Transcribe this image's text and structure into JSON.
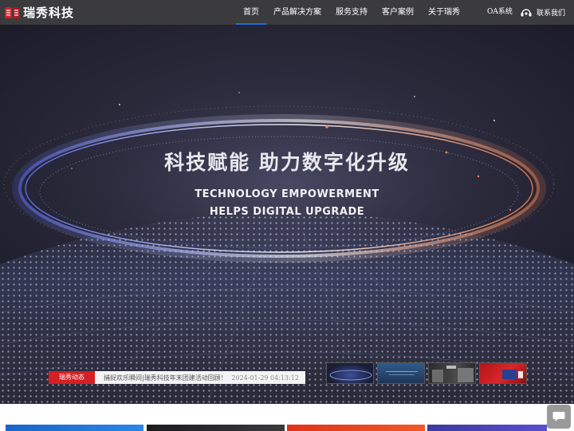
{
  "header": {
    "logo_text": "瑞秀科技",
    "nav": [
      {
        "label": "首页",
        "active": true
      },
      {
        "label": "产品解决方案",
        "active": false
      },
      {
        "label": "服务支持",
        "active": false
      },
      {
        "label": "客户案例",
        "active": false
      },
      {
        "label": "关于瑞秀",
        "active": false
      }
    ],
    "oa_label": "OA系统",
    "contact_label": "联系我们"
  },
  "hero": {
    "title": "科技赋能  助力数字化升级",
    "subtitle_line1": "TECHNOLOGY EMPOWERMENT",
    "subtitle_line2": "HELPS DIGITAL UPGRADE"
  },
  "news": {
    "tag": "瑞秀动态",
    "headline": "捕捉欢乐瞬间|瑞秀科技年末团建活动回顾！",
    "date": "2024-01-29 04:13:12"
  },
  "colors": {
    "header_bg": "#3b3b3d",
    "accent_red": "#d41f24",
    "nav_active": "#1e6fd9"
  }
}
